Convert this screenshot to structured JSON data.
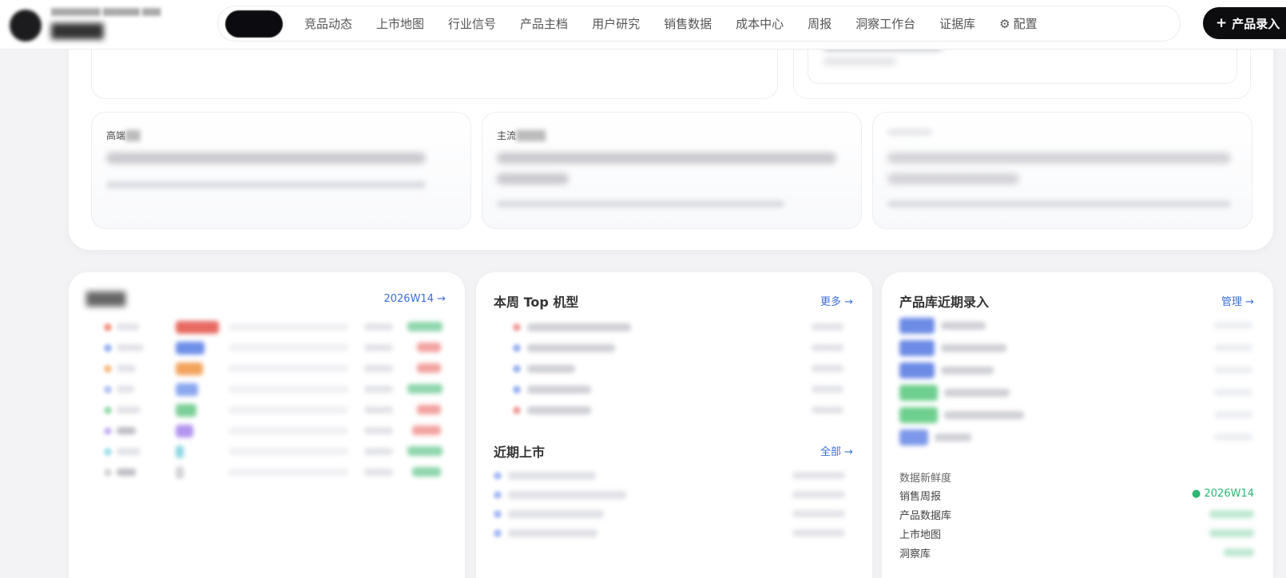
{
  "topbar": {
    "brand_sub": "████████ ██████ ███",
    "brand_name": "█████",
    "nav": [
      {
        "label": "竞品动态"
      },
      {
        "label": "上市地图"
      },
      {
        "label": "行业信号"
      },
      {
        "label": "产品主档"
      },
      {
        "label": "用户研究"
      },
      {
        "label": "销售数据"
      },
      {
        "label": "成本中心"
      },
      {
        "label": "周报"
      },
      {
        "label": "洞察工作台"
      },
      {
        "label": "证据库"
      },
      {
        "label": "配置",
        "icon": "gear-icon"
      }
    ],
    "add_button": {
      "icon": "plus-icon",
      "label": "产品录入"
    }
  },
  "segments": [
    {
      "label": "高端"
    },
    {
      "label": "主流"
    }
  ],
  "cards": {
    "share": {
      "title": "████",
      "link": "2026W14 →"
    },
    "top_models": {
      "title": "本周 Top 机型",
      "link": "更多 →"
    },
    "upcoming": {
      "title": "近期上市",
      "link": "全部 →"
    },
    "product_db": {
      "title": "产品库近期录入",
      "link": "管理 →"
    },
    "freshness": {
      "title": "数据新鲜度",
      "rows": [
        {
          "label": "销售周报",
          "value": "● 2026W14"
        },
        {
          "label": "产品数据库"
        },
        {
          "label": "上市地图"
        },
        {
          "label": "洞察库"
        }
      ]
    }
  },
  "colors": {
    "accent_blue": "#3b6fd8",
    "fresh_green": "#2bb673",
    "nav_active": "#0c0c10"
  }
}
